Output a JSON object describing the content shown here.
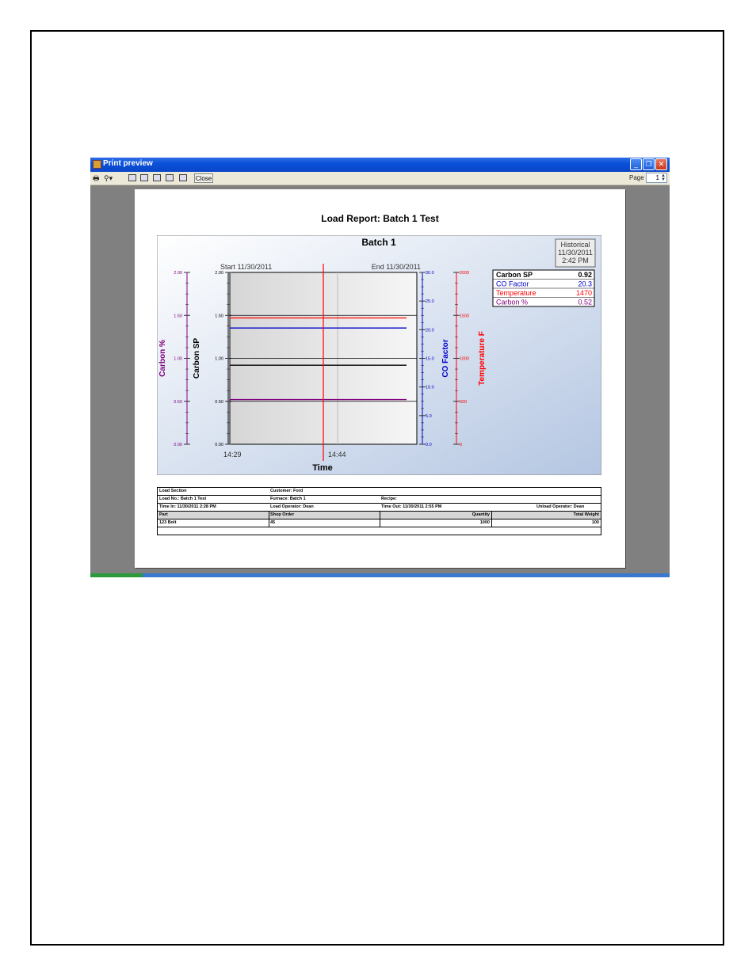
{
  "window": {
    "title": "Print preview",
    "minimize_glyph": "_",
    "maximize_glyph": "❐",
    "close_glyph": "✕",
    "toolbar": {
      "print_icon": "printer-icon",
      "zoom_icon": "magnifier-icon",
      "close_label": "Close",
      "page_label": "Page",
      "page_value": "1"
    }
  },
  "report": {
    "title": "Load Report:  Batch 1 Test",
    "historical_box": [
      "Historical",
      "11/30/2011",
      "2:42 PM"
    ],
    "table": {
      "row1": {
        "load_section": "Load Section",
        "customer": "Customer: Ford"
      },
      "row2": {
        "load_no": "Load No.: Batch 1 Test",
        "furnace": "Furnace: Batch 1",
        "recipe": "Recipe:"
      },
      "row3": {
        "time_in": "Time In: 11/30/2011  2:28  PM",
        "load_operator": "Load Operator: Dean",
        "time_out": "Time Out: 11/30/2011  2:55  PM",
        "unload_operator": "Unload Operator: Dean"
      },
      "headers": [
        "Part",
        "Shop Order",
        "Quantity",
        "Total  Weight"
      ],
      "rows": [
        [
          "123 Bolt",
          "45",
          "1000",
          "100"
        ]
      ]
    }
  },
  "chart_data": {
    "type": "line",
    "title": "Batch 1",
    "xlabel": "Time",
    "start_label": "Start 11/30/2011",
    "end_label": "End 11/30/2011",
    "x_tick_labels": [
      "14:29",
      "14:44"
    ],
    "x": [
      "14:29",
      "14:55"
    ],
    "cursor_time": "14:44",
    "grid": true,
    "legend_position": "top-right",
    "axes": [
      {
        "name": "Carbon %",
        "color": "#800080",
        "min": 0,
        "max": 2,
        "ticks": [
          "0.00",
          "0.50",
          "1.00",
          "1.50",
          "2.00"
        ]
      },
      {
        "name": "Carbon SP",
        "color": "#000000",
        "min": 0,
        "max": 2,
        "ticks": [
          "0.00",
          "0.50",
          "1.00",
          "1.50",
          "2.00"
        ]
      },
      {
        "name": "CO Factor",
        "color": "#0000cc",
        "min": 0,
        "max": 30,
        "ticks": [
          "0.0",
          "5.0",
          "10.0",
          "15.0",
          "20.0",
          "25.0",
          "30.0"
        ]
      },
      {
        "name": "Temperature F",
        "color": "#ff0000",
        "min": 0,
        "max": 2000,
        "ticks": [
          "0",
          "500",
          "1000",
          "1500",
          "2000"
        ]
      }
    ],
    "series": [
      {
        "name": "Carbon SP",
        "axis": 1,
        "color": "#000000",
        "values": [
          0.92,
          0.92
        ],
        "legend_value": "0.92"
      },
      {
        "name": "CO Factor",
        "axis": 2,
        "color": "#0000cc",
        "values": [
          20.3,
          20.3
        ],
        "legend_value": "20.3"
      },
      {
        "name": "Temperature",
        "axis": 3,
        "color": "#ff0000",
        "values": [
          1470,
          1470
        ],
        "legend_value": "1470"
      },
      {
        "name": "Carbon %",
        "axis": 0,
        "color": "#800080",
        "values": [
          0.52,
          0.52
        ],
        "legend_value": "0.52"
      }
    ],
    "extra_lines": [
      {
        "axis": 1,
        "color": "#000000",
        "value": 1.0
      },
      {
        "axis": 1,
        "color": "#000000",
        "value": 0.5
      },
      {
        "axis": 1,
        "color": "#000000",
        "value": 1.5
      }
    ]
  }
}
